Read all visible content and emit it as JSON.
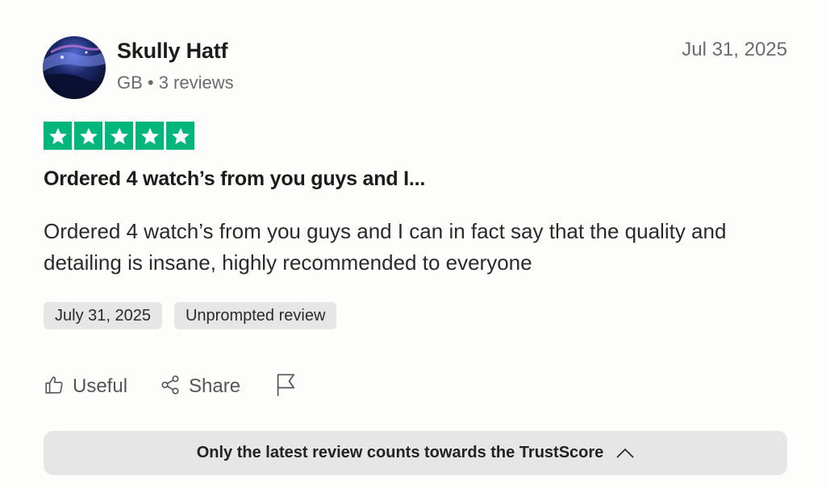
{
  "reviewer": {
    "name": "Skully Hatf",
    "country": "GB",
    "reviews_count": "3 reviews",
    "meta": "GB • 3 reviews"
  },
  "review": {
    "date": "Jul 31, 2025",
    "rating": 5,
    "rating_max": 5,
    "title": "Ordered 4 watch’s from you guys and I...",
    "body": "Ordered 4 watch’s from you guys and I can in fact say that the quality and detailing is insane, highly recommended to everyone",
    "experience_date": "July 31, 2025",
    "review_type": "Unprompted review"
  },
  "actions": {
    "useful_label": "Useful",
    "share_label": "Share"
  },
  "notice": {
    "text": "Only the latest review counts towards the TrustScore"
  },
  "icons": {
    "avatar": "avatar-image",
    "star": "star-icon",
    "useful": "thumbs-up-icon",
    "share": "share-icon",
    "flag": "flag-icon",
    "chevron": "chevron-up-icon"
  },
  "colors": {
    "star_green": "#00b67a",
    "tag_bg": "#e6e6e6",
    "muted_text": "#6b6b6b"
  }
}
